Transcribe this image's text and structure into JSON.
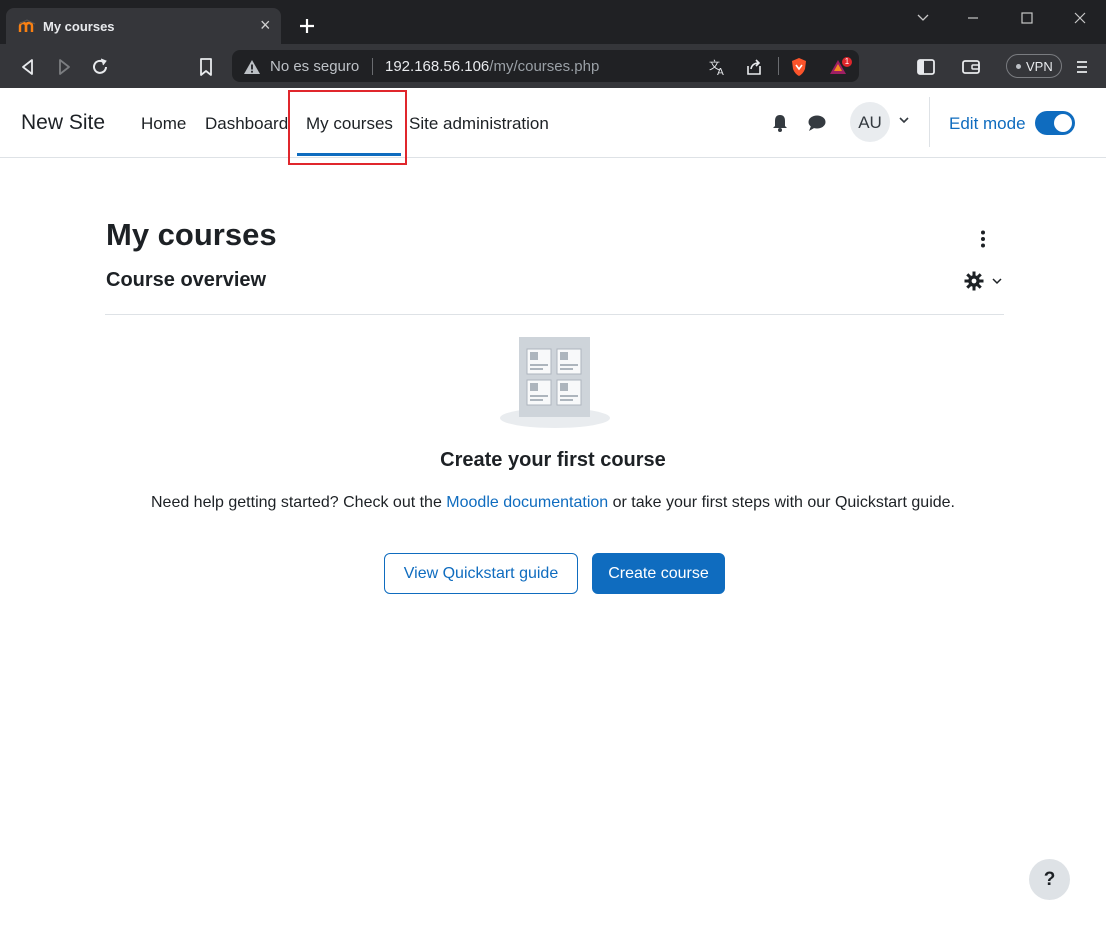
{
  "browser": {
    "tab": {
      "title": "My courses",
      "close": "×"
    },
    "omnibox": {
      "security": "No es seguro",
      "host": "192.168.56.106",
      "path": "/my/courses.php"
    },
    "badges": {
      "rewards_count": "1"
    },
    "vpn_label": "VPN"
  },
  "navbar": {
    "site_name": "New Site",
    "items": [
      {
        "label": "Home"
      },
      {
        "label": "Dashboard"
      },
      {
        "label": "My courses",
        "active": true
      },
      {
        "label": "Site administration"
      }
    ],
    "avatar_initials": "AU",
    "edit_mode_label": "Edit mode",
    "edit_mode_on": true
  },
  "page": {
    "title": "My courses",
    "block_title": "Course overview"
  },
  "empty_state": {
    "heading": "Create your first course",
    "text_before": "Need help getting started? Check out the ",
    "doc_link": "Moodle documentation",
    "text_after": " or take your first steps with our Quickstart guide."
  },
  "buttons": {
    "quickstart": "View Quickstart guide",
    "create_course": "Create course"
  },
  "help_button": "?",
  "colors": {
    "brand_primary": "#0f6cbf",
    "highlight": "#e0262c"
  }
}
